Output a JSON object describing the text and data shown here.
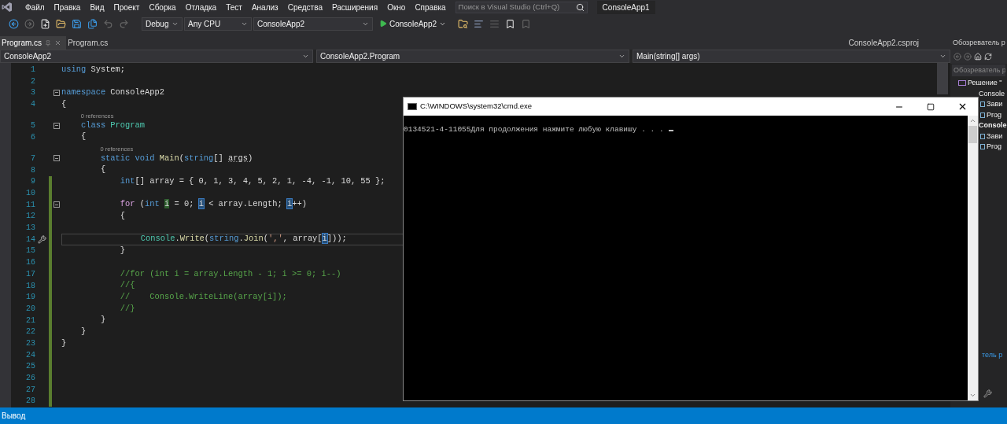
{
  "menu": [
    "Файл",
    "Правка",
    "Вид",
    "Проект",
    "Сборка",
    "Отладка",
    "Тест",
    "Анализ",
    "Средства",
    "Расширения",
    "Окно",
    "Справка"
  ],
  "search": {
    "placeholder": "Поиск в Visual Studio (Ctrl+Q)"
  },
  "solution_name": "ConsoleApp1",
  "toolbar": {
    "configuration": "Debug",
    "platform": "Any CPU",
    "startup_project": "ConsoleApp2",
    "run_label": "ConsoleApp2"
  },
  "tabs": [
    {
      "label": "Program.cs",
      "selected": true
    },
    {
      "label": "Program.cs",
      "selected": false
    }
  ],
  "preview_tab": {
    "label": "ConsoleApp2.csproj"
  },
  "navigation_bar": {
    "project": "ConsoleApp2",
    "type": "ConsoleApp2.Program",
    "member": "Main(string[] args)"
  },
  "editor": {
    "lines": [
      {
        "kind": "code",
        "number": "1",
        "fold": false,
        "modified": false,
        "current": false,
        "segments": [
          {
            "kind": "kw",
            "text": "using"
          },
          {
            "kind": "plain",
            "text": " System;"
          }
        ]
      },
      {
        "kind": "code",
        "number": "2",
        "fold": false,
        "modified": false,
        "current": false
      },
      {
        "kind": "code",
        "number": "3",
        "fold": true,
        "modified": false,
        "current": false,
        "segments": [
          {
            "kind": "kw",
            "text": "namespace"
          },
          {
            "kind": "plain",
            "text": " ConsoleApp2"
          }
        ]
      },
      {
        "kind": "code",
        "number": "4",
        "fold": false,
        "modified": false,
        "current": false,
        "segments": [
          {
            "kind": "plain",
            "text": "{"
          }
        ]
      },
      {
        "kind": "codelens",
        "text": "0 references"
      },
      {
        "kind": "code",
        "number": "5",
        "fold": true,
        "modified": false,
        "current": false,
        "segments": [
          {
            "kind": "kw",
            "text": "    class "
          },
          {
            "kind": "type",
            "text": "Program"
          }
        ]
      },
      {
        "kind": "code",
        "number": "6",
        "fold": false,
        "modified": false,
        "current": false,
        "segments": [
          {
            "kind": "plain",
            "text": "    {"
          }
        ]
      },
      {
        "kind": "codelens",
        "text": "0 references"
      },
      {
        "kind": "code",
        "number": "7",
        "fold": true,
        "modified": false,
        "current": false,
        "segments": [
          {
            "kind": "kw",
            "text": "        static void "
          },
          {
            "kind": "method",
            "text": "Main"
          },
          {
            "kind": "plain",
            "text": "("
          },
          {
            "kind": "kw",
            "text": "string"
          },
          {
            "kind": "plain",
            "text": "[] "
          },
          {
            "kind": "hint",
            "text": "args"
          },
          {
            "kind": "plain",
            "text": ")"
          }
        ]
      },
      {
        "kind": "code",
        "number": "8",
        "fold": false,
        "modified": false,
        "current": false,
        "segments": [
          {
            "kind": "plain",
            "text": "        {"
          }
        ]
      },
      {
        "kind": "code",
        "number": "9",
        "fold": false,
        "modified": true,
        "current": false,
        "segments": [
          {
            "kind": "kw",
            "text": "            int"
          },
          {
            "kind": "plain",
            "text": "[] array = { 0, 1, 3, 4, 5, 2, 1, -4, -1, 10, 55 };"
          }
        ]
      },
      {
        "kind": "code",
        "number": "10",
        "fold": false,
        "modified": true,
        "current": false
      },
      {
        "kind": "code",
        "number": "11",
        "fold": true,
        "modified": true,
        "current": false,
        "segments": [
          {
            "kind": "control",
            "text": "            for"
          },
          {
            "kind": "plain",
            "text": " ("
          },
          {
            "kind": "kw",
            "text": "int "
          },
          {
            "kind": "def",
            "text": "i"
          },
          {
            "kind": "plain",
            "text": " = 0; "
          },
          {
            "kind": "ref",
            "text": "i"
          },
          {
            "kind": "plain",
            "text": " < array.Length; "
          },
          {
            "kind": "ref",
            "text": "i"
          },
          {
            "kind": "plain",
            "text": "++)"
          }
        ]
      },
      {
        "kind": "code",
        "number": "12",
        "fold": false,
        "modified": true,
        "current": false,
        "segments": [
          {
            "kind": "plain",
            "text": "            {"
          }
        ]
      },
      {
        "kind": "code",
        "number": "13",
        "fold": false,
        "modified": true,
        "current": false
      },
      {
        "kind": "code",
        "number": "14",
        "fold": false,
        "modified": true,
        "current": true,
        "segments": [
          {
            "kind": "type",
            "text": "                Console"
          },
          {
            "kind": "plain",
            "text": "."
          },
          {
            "kind": "method",
            "text": "Write"
          },
          {
            "kind": "plain",
            "text": "("
          },
          {
            "kind": "kw",
            "text": "string"
          },
          {
            "kind": "plain",
            "text": "."
          },
          {
            "kind": "method",
            "text": "Join"
          },
          {
            "kind": "plain",
            "text": "("
          },
          {
            "kind": "str",
            "text": "','"
          },
          {
            "kind": "plain",
            "text": ", array["
          },
          {
            "kind": "ref",
            "text": "i"
          },
          {
            "kind": "plain",
            "text": "]));"
          }
        ]
      },
      {
        "kind": "code",
        "number": "15",
        "fold": false,
        "modified": true,
        "current": false,
        "segments": [
          {
            "kind": "plain",
            "text": "            }"
          }
        ]
      },
      {
        "kind": "code",
        "number": "16",
        "fold": false,
        "modified": true,
        "current": false
      },
      {
        "kind": "code",
        "number": "17",
        "fold": false,
        "modified": true,
        "current": false,
        "segments": [
          {
            "kind": "comment",
            "text": "            //for (int i = array.Length - 1; i >= 0; i--)"
          }
        ]
      },
      {
        "kind": "code",
        "number": "18",
        "fold": false,
        "modified": true,
        "current": false,
        "segments": [
          {
            "kind": "comment",
            "text": "            //{"
          }
        ]
      },
      {
        "kind": "code",
        "number": "19",
        "fold": false,
        "modified": true,
        "current": false,
        "segments": [
          {
            "kind": "comment",
            "text": "            //    Console.WriteLine(array[i]);"
          }
        ]
      },
      {
        "kind": "code",
        "number": "20",
        "fold": false,
        "modified": true,
        "current": false,
        "segments": [
          {
            "kind": "comment",
            "text": "            //}"
          }
        ]
      },
      {
        "kind": "code",
        "number": "21",
        "fold": false,
        "modified": true,
        "current": false,
        "segments": [
          {
            "kind": "plain",
            "text": "        }"
          }
        ]
      },
      {
        "kind": "code",
        "number": "22",
        "fold": false,
        "modified": true,
        "current": false,
        "segments": [
          {
            "kind": "plain",
            "text": "    }"
          }
        ]
      },
      {
        "kind": "code",
        "number": "23",
        "fold": false,
        "modified": true,
        "current": false,
        "segments": [
          {
            "kind": "plain",
            "text": "}"
          }
        ]
      },
      {
        "kind": "code",
        "number": "24",
        "fold": false,
        "modified": true,
        "current": false
      },
      {
        "kind": "code",
        "number": "25",
        "fold": false,
        "modified": true,
        "current": false
      },
      {
        "kind": "code",
        "number": "26",
        "fold": false,
        "modified": true,
        "current": false
      },
      {
        "kind": "code",
        "number": "27",
        "fold": false,
        "modified": true,
        "current": false
      },
      {
        "kind": "code",
        "number": "28",
        "fold": false,
        "modified": true,
        "current": false
      }
    ]
  },
  "console_window": {
    "title": "C:\\WINDOWS\\system32\\cmd.exe",
    "output": "0134521-4-11055Для продолжения нажмите любую клавишу . . ."
  },
  "solution_explorer": {
    "title": "Обозреватель р",
    "search": {
      "placeholder": "Обозреватель р"
    },
    "tree": [
      {
        "label": "Решение \"",
        "startup": false,
        "children": [
          {
            "label": "Console",
            "startup": false,
            "children": [
              {
                "label": "Зави",
                "startup": false
              },
              {
                "label": "Prog",
                "startup": false
              }
            ]
          },
          {
            "label": "Console",
            "startup": true,
            "children": [
              {
                "label": "Зави",
                "startup": false
              },
              {
                "label": "Prog",
                "startup": false
              }
            ]
          }
        ]
      }
    ],
    "footer_tab": "тель р"
  },
  "status_bar": {
    "label": "Вывод"
  }
}
